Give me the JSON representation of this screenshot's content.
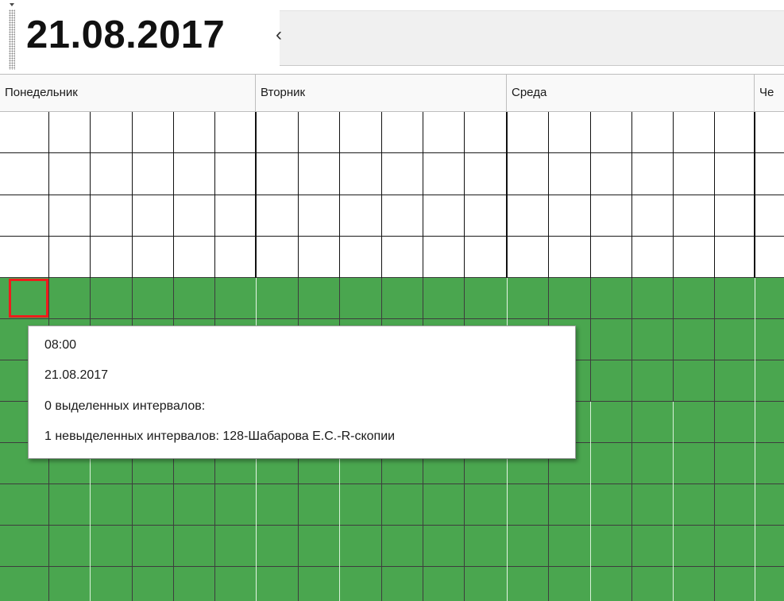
{
  "toolbar": {
    "date": "21.08.2017",
    "prev_label": "‹",
    "grip_icon": "toolbar-grip-icon"
  },
  "week": {
    "days": [
      {
        "label": "Понедельник"
      },
      {
        "label": "Вторник"
      },
      {
        "label": "Среда"
      },
      {
        "label": "Че"
      }
    ]
  },
  "grid": {
    "available_color": "#4aa64f",
    "empty_color": "#ffffff",
    "selection_color": "#ee1c1c",
    "rows_empty": 4,
    "columns_per_day": 6
  },
  "tooltip": {
    "time": "08:00",
    "date": "21.08.2017",
    "selected": "0 выделенных интервалов:",
    "unselected": "1 невыделенных интервалов: 128-Шабарова Е.С.-R-скопии"
  }
}
